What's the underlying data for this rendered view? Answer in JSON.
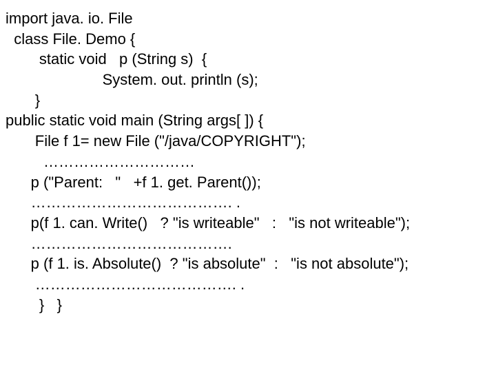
{
  "code": {
    "line1": "import java. io. File",
    "line2": "  class File. Demo {",
    "line3": "        static void   p (String s)  {",
    "line4": "                       System. out. println (s);",
    "line5": "       }",
    "line6": "public static void main (String args[ ]) {",
    "line7": "       File f 1= new File (\"/java/COPYRIGHT\");",
    "line8": "         …………………………",
    "line9": "      p (\"Parent:   \"   +f 1. get. Parent());",
    "line10": "      …………………………………. .",
    "line11": "      p(f 1. can. Write()   ? \"is writeable\"   :   \"is not writeable\");",
    "line12": "      ………………………………….",
    "line13": "      p (f 1. is. Absolute()  ? \"is absolute\"  :   \"is not absolute\");",
    "line14": "       …………………………………. .",
    "line15": "        }   }"
  }
}
